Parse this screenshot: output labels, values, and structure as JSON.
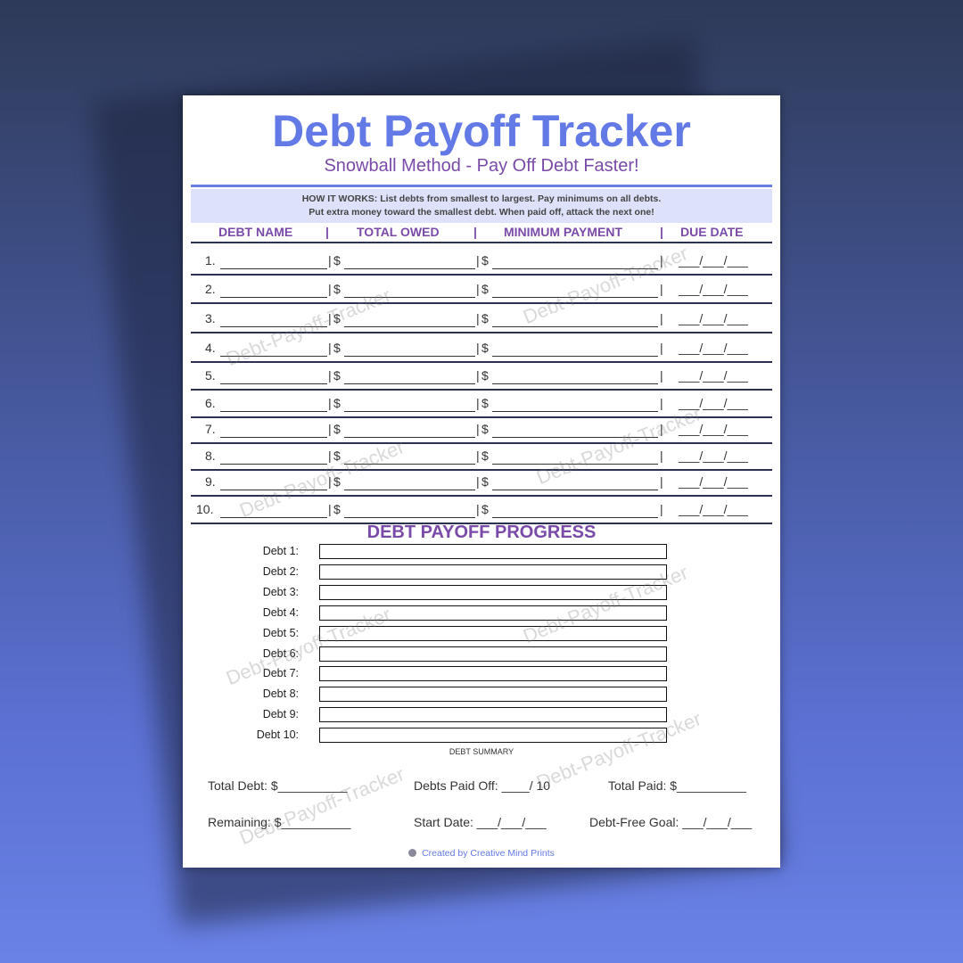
{
  "title": "Debt Payoff Tracker",
  "subtitle": "Snowball Method - Pay Off Debt Faster!",
  "how_it_works": {
    "label": "HOW IT WORKS:",
    "line1": "List debts from smallest to largest. Pay minimums on all debts.",
    "line2": "Put extra money toward the smallest debt. When paid off, attack the next one!"
  },
  "columns": [
    "DEBT NAME",
    "TOTAL OWED",
    "MINIMUM PAYMENT",
    "DUE DATE"
  ],
  "column_separator": "|",
  "row_numbers": [
    "1.",
    "2.",
    "3.",
    "4.",
    "5.",
    "6.",
    "7.",
    "8.",
    "9.",
    "10."
  ],
  "currency_symbol": "$",
  "date_blank": "___/___/___",
  "progress": {
    "title": "DEBT PAYOFF PROGRESS",
    "labels": [
      "Debt 1:",
      "Debt 2:",
      "Debt 3:",
      "Debt 4:",
      "Debt 5:",
      "Debt 6:",
      "Debt 7:",
      "Debt 8:",
      "Debt 9:",
      "Debt 10:"
    ]
  },
  "summary": {
    "caption": "DEBT SUMMARY",
    "total_debt": "Total Debt: $__________",
    "debts_paid_off": "Debts Paid Off: ____/ 10",
    "total_paid": "Total Paid: $__________",
    "remaining": "Remaining: $__________",
    "start_date": "Start Date: ___/___/___",
    "debt_free_goal": "Debt-Free Goal: ___/___/___"
  },
  "credit": "Created by Creative Mind Prints",
  "watermark": "Debt-Payoff-Tracker",
  "colors": {
    "title": "#6379e6",
    "accent_purple": "#7a4aa8",
    "box": "#dde2fa"
  }
}
